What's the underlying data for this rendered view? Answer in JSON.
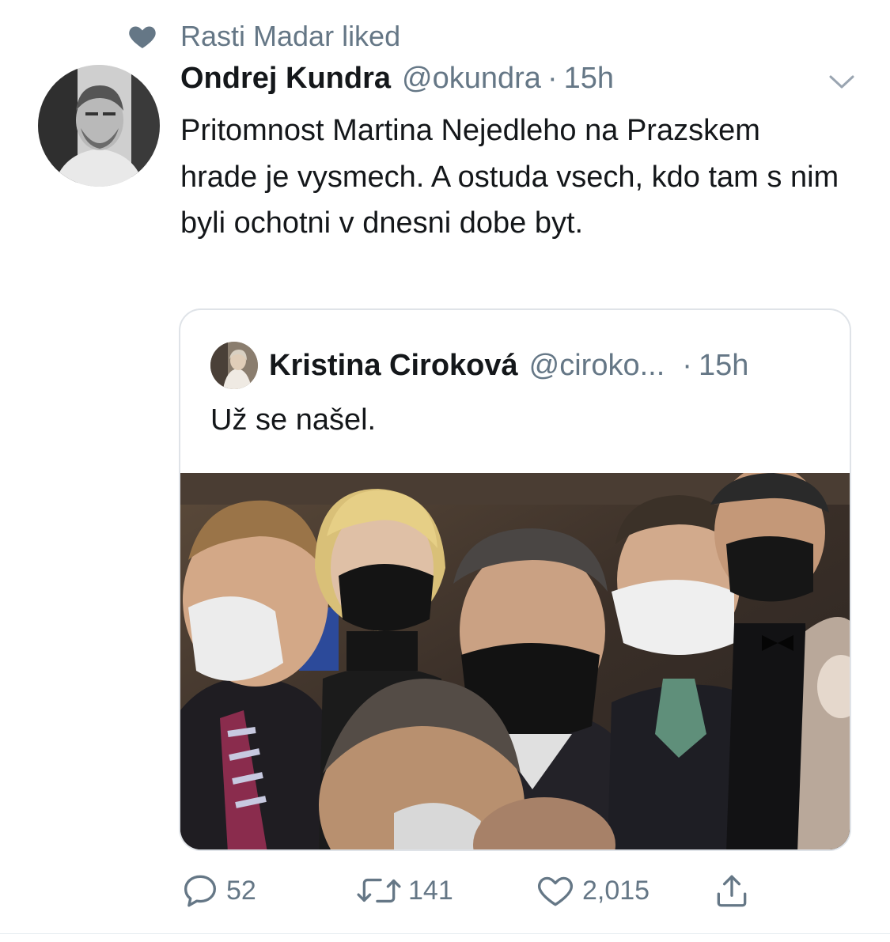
{
  "social_context": {
    "icon": "heart-icon",
    "text": "Rasti Madar liked"
  },
  "tweet": {
    "author_name": "Ondrej Kundra",
    "author_handle": "@okundra",
    "separator": "·",
    "time": "15h",
    "text": "Pritomnost Martina Nejedleho na Prazskem hrade je vysmech. A ostuda vsech, kdo tam s nim byli ochotni v dnesni dobe byt."
  },
  "quote": {
    "author_name": "Kristina Ciroková",
    "author_handle": "@ciroko...",
    "separator": "·",
    "time": "15h",
    "text": "Už se našel."
  },
  "actions": {
    "reply_count": "52",
    "retweet_count": "141",
    "like_count": "2,015"
  },
  "colors": {
    "text_primary": "#14171a",
    "text_secondary": "#657786",
    "border": "#dfe3e8"
  }
}
